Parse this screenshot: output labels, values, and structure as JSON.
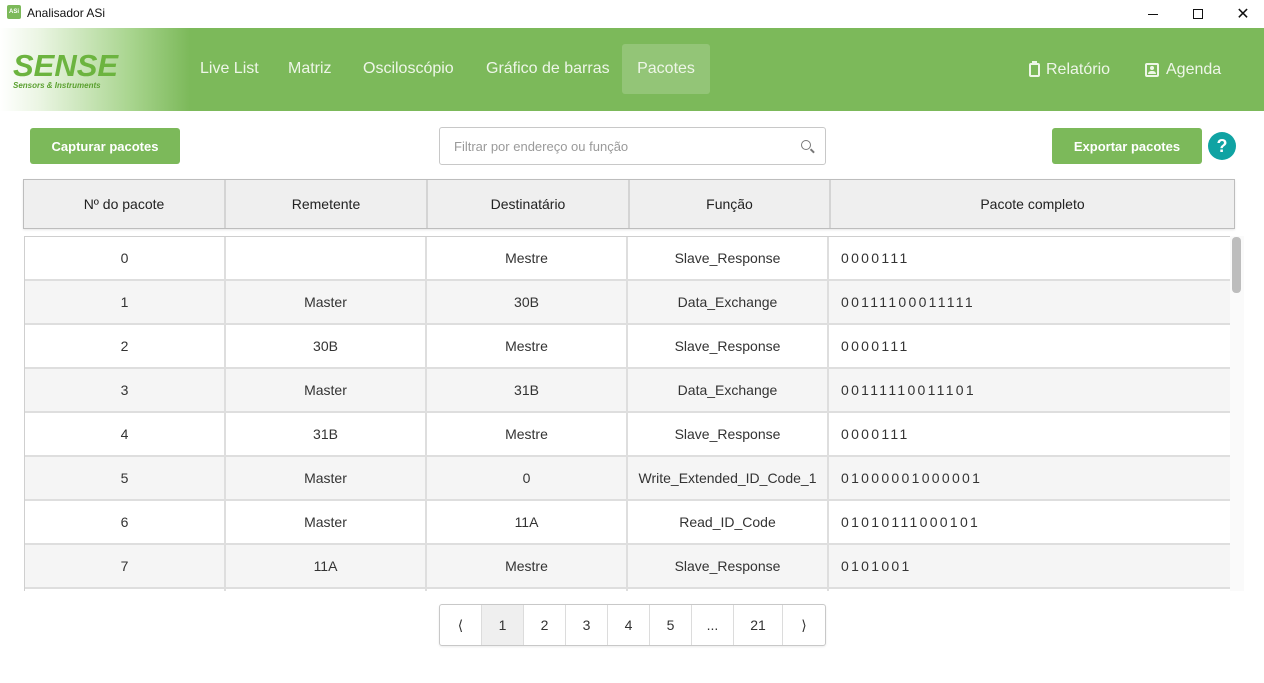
{
  "window": {
    "title": "Analisador ASi",
    "icon_text": "ASi",
    "controls": [
      "minimize",
      "maximize",
      "close"
    ]
  },
  "header": {
    "logo": {
      "main": "SENSE",
      "sub": "Sensors & Instruments"
    },
    "nav": [
      {
        "label": "Live List",
        "active": false
      },
      {
        "label": "Matriz",
        "active": false
      },
      {
        "label": "Osciloscópio",
        "active": false
      },
      {
        "label": "Gráfico de barras",
        "active": false
      },
      {
        "label": "Pacotes",
        "active": true
      }
    ],
    "right_links": [
      {
        "label": "Relatório",
        "icon": "clipboard-icon"
      },
      {
        "label": "Agenda",
        "icon": "contact-book-icon"
      }
    ]
  },
  "toolbar": {
    "capture_label": "Capturar pacotes",
    "search_placeholder": "Filtrar por endereço ou função",
    "search_value": "",
    "export_label": "Exportar pacotes",
    "help_label": "?"
  },
  "table": {
    "columns": [
      "Nº do pacote",
      "Remetente",
      "Destinatário",
      "Função",
      "Pacote completo"
    ],
    "rows": [
      [
        "0",
        "",
        "Mestre",
        "Slave_Response",
        "0000111"
      ],
      [
        "1",
        "Master",
        "30B",
        "Data_Exchange",
        "00111100011111"
      ],
      [
        "2",
        "30B",
        "Mestre",
        "Slave_Response",
        "0000111"
      ],
      [
        "3",
        "Master",
        "31B",
        "Data_Exchange",
        "00111110011101"
      ],
      [
        "4",
        "31B",
        "Mestre",
        "Slave_Response",
        "0000111"
      ],
      [
        "5",
        "Master",
        "0",
        "Write_Extended_ID_Code_1",
        "01000001000001"
      ],
      [
        "6",
        "Master",
        "11A",
        "Read_ID_Code",
        "01010111000101"
      ],
      [
        "7",
        "11A",
        "Mestre",
        "Slave_Response",
        "0101001"
      ],
      [
        "",
        "",
        "",
        "",
        ""
      ]
    ]
  },
  "pagination": {
    "prev": "⟨",
    "pages": [
      "1",
      "2",
      "3",
      "4",
      "5",
      "...",
      "21"
    ],
    "current": "1",
    "next": "⟩"
  },
  "colors": {
    "brand_green": "#7cb95a",
    "help_teal": "#10a3a3"
  }
}
